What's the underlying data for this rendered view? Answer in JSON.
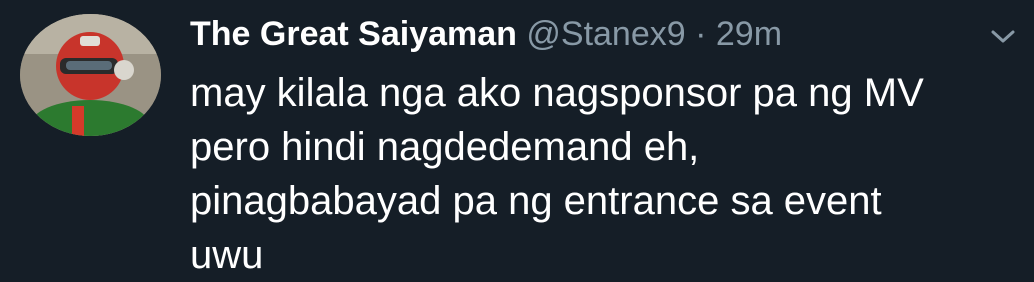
{
  "tweet": {
    "display_name": "The Great Saiyaman",
    "handle": "@Stanex9",
    "separator": "·",
    "time": "29m",
    "text_lines": [
      "may kilala nga ako nagsponsor pa ng MV",
      "pero hindi nagdedemand eh,",
      "pinagbabayad pa ng entrance sa event",
      "uwu"
    ]
  },
  "icons": {
    "avatar": "avatar-image",
    "menu": "chevron-down-icon"
  },
  "colors": {
    "background": "#151e27",
    "primary_text": "#ffffff",
    "secondary_text": "#8899a6"
  }
}
